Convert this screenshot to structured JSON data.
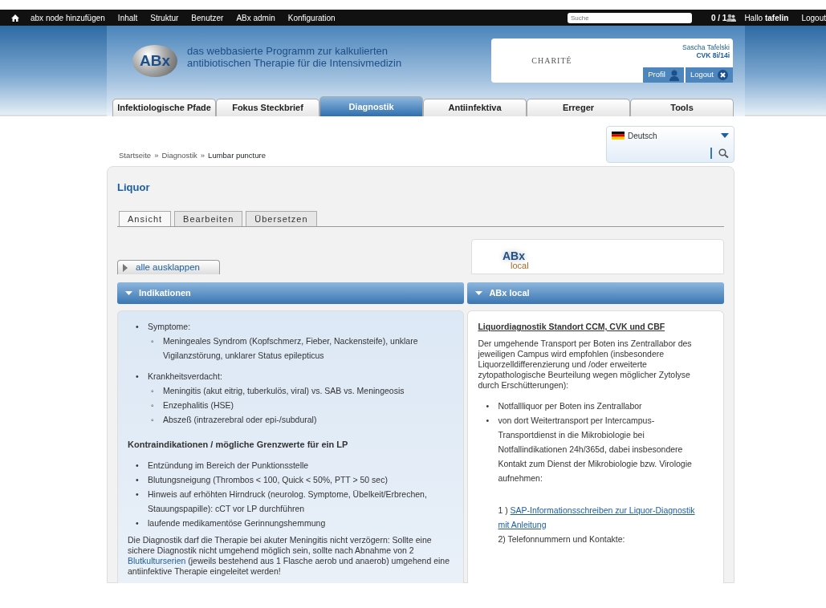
{
  "admin_bar": {
    "items": [
      "abx node hinzufügen",
      "Inhalt",
      "Struktur",
      "Benutzer",
      "ABx admin",
      "Konfiguration"
    ],
    "search": {
      "placeholder": "Suche"
    },
    "counter": "0 / 1",
    "greeting": "Hallo",
    "user": "tafelin",
    "logout": "Logout"
  },
  "header": {
    "logo": "ABx",
    "tagline": "das webbasierte Programm zur kalkulierten antibiotischen Therapie für die Intensivmedizin",
    "partner_logo": "CHARITÉ",
    "user_name": "Sascha Tafelski",
    "unit": "CVK 8i/14i",
    "buttons": [
      {
        "kind": "profile",
        "label": "Profil"
      },
      {
        "kind": "logout",
        "label": "Logout"
      }
    ]
  },
  "main_tabs": [
    {
      "label": "Infektiologische Pfade",
      "selected": false
    },
    {
      "label": "Fokus Steckbrief",
      "selected": false
    },
    {
      "label": "Diagnostik",
      "selected": true
    },
    {
      "label": "Antiinfektiva",
      "selected": false
    },
    {
      "label": "Erreger",
      "selected": false
    },
    {
      "label": "Tools",
      "selected": false
    }
  ],
  "language": {
    "value": "Deutsch"
  },
  "breadcrumb": {
    "separator": "»",
    "items": [
      "Startseite",
      "Diagnostik",
      "Lumbar puncture"
    ]
  },
  "page_title": "Liquor",
  "content_tabs": [
    {
      "label": "Ansicht",
      "selected": true
    },
    {
      "label": "Bearbeiten",
      "selected": false
    },
    {
      "label": "Übersetzen",
      "selected": false
    }
  ],
  "expand_button": "alle ausklappen",
  "local_logo": {
    "main": "ABx",
    "sub": "local"
  },
  "sections": [
    {
      "title": "Indikationen",
      "blocks": [
        {
          "kind": "list",
          "items": [
            {
              "marker": "•",
              "text": "Symptome:",
              "children": [
                {
                  "marker": "◦",
                  "text": "Meningeales Syndrom (Kopfschmerz, Fieber, Nackensteife), unklare Vigilanzstörung, unklarer Status epilepticus"
                }
              ]
            },
            {
              "marker": "•",
              "text": "Krankheitsverdacht:",
              "children": [
                {
                  "marker": "◦",
                  "text": "Meningitis (akut eitrig, tuberkulös, viral) vs. SAB vs. Meningeosis"
                },
                {
                  "marker": "◦",
                  "text": "Enzephalitis (HSE)"
                },
                {
                  "marker": "◦",
                  "text": "Abszeß (intrazerebral oder epi-/subdural)"
                }
              ]
            }
          ]
        },
        {
          "kind": "heading",
          "text": "Kontraindikationen / mögliche Grenzwerte für ein LP"
        },
        {
          "kind": "list",
          "items": [
            {
              "marker": "•",
              "text": "Entzündung im Bereich der Punktionsstelle"
            },
            {
              "marker": "•",
              "text": "Blutungsneigung (Thrombos < 100, Quick < 50%, PTT > 50 sec)"
            },
            {
              "marker": "•",
              "text": "Hinweis auf erhöhten Hirndruck (neurolog. Symptome, Übelkeit/Erbrechen, Stauungspapille): cCT vor LP durchführen"
            },
            {
              "marker": "•",
              "text": "laufende medikamentöse Gerinnungshemmung"
            }
          ]
        },
        {
          "kind": "paragraph",
          "parts": [
            {
              "kind": "text",
              "text": "Die Diagnostik darf die Therapie bei akuter Meningitis nicht verzögern: Sollte eine sichere Diagnostik nicht umgehend möglich sein, sollte nach Abnahme von 2 "
            },
            {
              "kind": "link",
              "text": "Blutkulturserien"
            },
            {
              "kind": "text",
              "text": " (jeweils bestehend aus 1 Flasche aerob und anaerob) umgehend eine antiinfektive Therapie eingeleitet werden!"
            }
          ]
        }
      ]
    },
    {
      "title": "ABx local",
      "blocks": [
        {
          "kind": "underlined_heading",
          "text": "Liquordiagnostik Standort CCM, CVK und CBF"
        },
        {
          "kind": "paragraph",
          "parts": [
            {
              "kind": "text",
              "text": "Der umgehende Transport per Boten ins Zentrallabor des jeweiligen Campus wird empfohlen (insbesondere Liquorzelldifferenzierung und /oder erweiterte zytopathologische Beurteilung wegen möglicher Zytolyse durch Erschütterungen):"
            }
          ]
        },
        {
          "kind": "list",
          "items": [
            {
              "marker": "•",
              "text": "Notfallliquor per Boten ins Zentrallabor"
            },
            {
              "marker": "•",
              "text": "von dort Weitertransport per Intercampus-Transportdienst in die Mikrobiologie bei Notfallindikationen 24h/365d, dabei insbesondere Kontakt zum Dienst der Mikrobiologie bzw. Virologie aufnehmen:"
            }
          ]
        },
        {
          "kind": "numbered_link",
          "number": "1 )",
          "text": "SAP-Informationsschreiben zur Liquor-Diagnostik mit Anleitung"
        },
        {
          "kind": "line",
          "text": "2) Telefonnummern und Kontakte:"
        }
      ]
    }
  ]
}
